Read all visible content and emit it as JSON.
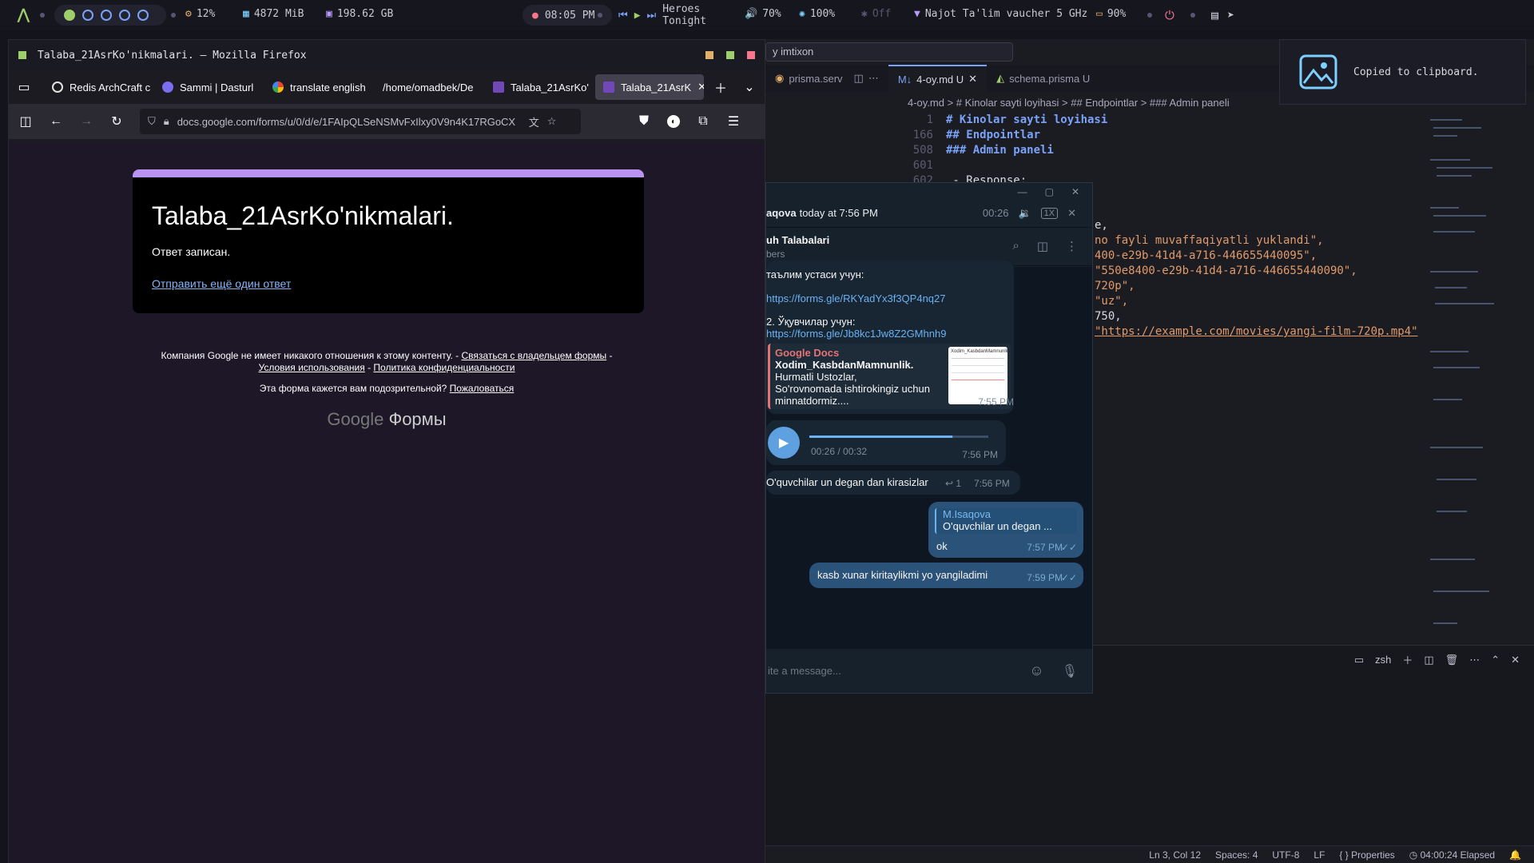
{
  "topbar": {
    "cpu": "12%",
    "ram": "4872 MiB",
    "disk": "198.62 GB",
    "clock": "08:05 PM",
    "track": "Heroes Tonight",
    "volume": "70%",
    "brightness": "100%",
    "bluetooth": "Off",
    "wifi": "Najot Ta'lim vaucher 5 GHz",
    "battery": "90%"
  },
  "firefox": {
    "window_title": "Talaba_21AsrKo'nikmalari. — Mozilla Firefox",
    "tabs": [
      {
        "label": "Redis ArchCraft c",
        "color": "#e2e2e2"
      },
      {
        "label": "Sammi | Dasturl",
        "color": "#7c6cf0"
      },
      {
        "label": "translate english",
        "color": "#4285f4"
      },
      {
        "label": "/home/omadbek/De",
        "color": "#1c1b22"
      },
      {
        "label": "Talaba_21AsrKo'",
        "color": "#7248b9"
      },
      {
        "label": "Talaba_21AsrK",
        "color": "#7248b9"
      }
    ],
    "url": "docs.google.com/forms/u/0/d/e/1FAIpQLSeNSMvFxIlxy0V9n4K17RGoCX",
    "form": {
      "title": "Talaba_21AsrKo'nikmalari.",
      "message": "Ответ записан.",
      "resubmit_link": "Отправить ещё один ответ",
      "disclaimer_pre": "Компания Google не имеет никакого отношения к этому контенту. - ",
      "contact_owner": "Связаться с владельцем формы",
      "disclaimer_dash": " -",
      "terms": "Условия использования",
      "terms_sep": " - ",
      "privacy": "Политика конфиденциальности",
      "suspicious": "Эта форма кажется вам подозрительной? ",
      "report": "Пожаловаться",
      "logo_google": "Google",
      "logo_forms": "Формы"
    }
  },
  "vscode": {
    "search": "y imtixon",
    "tabs": [
      {
        "label": "prisma.serv"
      },
      {
        "label": "4-oy.md U"
      },
      {
        "label": "schema.prisma U"
      }
    ],
    "breadcrumb": "4-oy.md  > # Kinolar sayti loyihasi  > ## Endpointlar  > ### Admin paneli",
    "lines": [
      {
        "n": "1",
        "text": "# Kinolar sayti loyihasi",
        "cls": "kw"
      },
      {
        "n": "166",
        "text": "## Endpointlar",
        "cls": "kw"
      },
      {
        "n": "508",
        "text": "### Admin paneli",
        "cls": "kw"
      },
      {
        "n": "601",
        "text": "",
        "cls": ""
      },
      {
        "n": "602",
        "text": "  - Response:",
        "cls": ""
      }
    ],
    "code_fragments": [
      {
        "text": "e,",
        "cls": ""
      },
      {
        "text": "no fayli muvaffaqiyatli yuklandi\",",
        "cls": "str"
      },
      {
        "text": "",
        "cls": ""
      },
      {
        "text": "400-e29b-41d4-a716-446655440095\",",
        "cls": "str"
      },
      {
        "text": "\"550e8400-e29b-41d4-a716-446655440090\",",
        "cls": "str"
      },
      {
        "text": "720p\",",
        "cls": "str"
      },
      {
        "text": "\"uz\",",
        "cls": "str"
      },
      {
        "text": "750,",
        "cls": ""
      },
      {
        "text": "\"https://example.com/movies/yangi-film-720p.mp4\"",
        "cls": "str"
      }
    ],
    "terminal_shell": "zsh",
    "status": {
      "position": "Ln 3, Col 12",
      "spaces": "Spaces: 4",
      "encoding": "UTF-8",
      "eol": "LF",
      "properties": "Properties",
      "elapsed": "04:00:24 Elapsed"
    }
  },
  "telegram": {
    "player": {
      "sender": "aqova",
      "when": "today at 7:56 PM",
      "time": "00:26",
      "speed": "1X"
    },
    "chat": {
      "name": "uh Talabalari",
      "sub": "bers"
    },
    "msg1_top": "таълим устаси учун:",
    "msg1_link1": "https://forms.gle/RKYadYx3f3QP4nq27",
    "msg1_item2": "2.  Ўқувчилар учун:",
    "msg1_link2": "https://forms.gle/Jb8kc1Jw8Z2GMhnh9",
    "preview": {
      "site": "Google Docs",
      "title": "Xodim_KasbdanMamnunlik.",
      "text1": "Hurmatli Ustozlar,",
      "text2": "So'rovnomada ishtirokingiz uchun",
      "text3": "minnatdormiz....",
      "thumb_title": "Xodim_KasbdanMamnunlik"
    },
    "msg1_time": "7:55 PM",
    "voice": {
      "duration": "00:26 / 00:32",
      "time": "7:56 PM",
      "progress": 0.8
    },
    "msg3": {
      "text": "O'quvchilar un degan dan kirasizlar",
      "replies": "1",
      "time": "7:56 PM"
    },
    "msg4": {
      "reply_name": "M.Isaqova",
      "reply_text": "O'quvchilar un degan ...",
      "text": "ok",
      "time": "7:57 PM"
    },
    "msg5": {
      "text": "kasb xunar kiritaylikmi yo yangiladimi",
      "time": "7:59 PM"
    },
    "input_placeholder": "ite a message..."
  },
  "notification": {
    "text": "Copied to clipboard."
  },
  "colors": {
    "accent": "#7aa2f7",
    "form_accent": "#b992f2",
    "tg_out": "#2b5278",
    "tg_in": "#182533"
  }
}
